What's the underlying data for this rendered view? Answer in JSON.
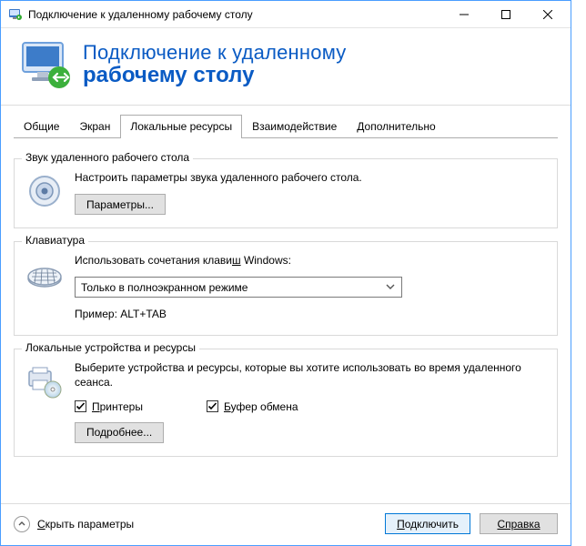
{
  "titlebar": {
    "title": "Подключение к удаленному рабочему столу"
  },
  "header": {
    "line1": "Подключение к удаленному",
    "line2": "рабочему столу"
  },
  "tabs": {
    "items": [
      {
        "label": "Общие"
      },
      {
        "label": "Экран"
      },
      {
        "label": "Локальные ресурсы"
      },
      {
        "label": "Взаимодействие"
      },
      {
        "label": "Дополнительно"
      }
    ],
    "active_index": 2
  },
  "groups": {
    "audio": {
      "legend": "Звук удаленного рабочего стола",
      "desc": "Настроить параметры звука удаленного рабочего стола.",
      "button": "Параметры..."
    },
    "keyboard": {
      "legend": "Клавиатура",
      "desc_prefix": "Использовать сочетания клави",
      "desc_under": "ш",
      "desc_suffix": " Windows:",
      "select_value": "Только в полноэкранном режиме",
      "example": "Пример: ALT+TAB"
    },
    "devices": {
      "legend": "Локальные устройства и ресурсы",
      "desc": "Выберите устройства и ресурсы, которые вы хотите использовать во время удаленного сеанса.",
      "chk_printers_under": "П",
      "chk_printers_rest": "ринтеры",
      "chk_clipboard_under": "Б",
      "chk_clipboard_rest": "уфер обмена",
      "button": "Подробнее..."
    }
  },
  "footer": {
    "toggle_under": "С",
    "toggle_rest": "крыть параметры",
    "connect_under": "П",
    "connect_rest": "одключить",
    "help": "Справка"
  }
}
